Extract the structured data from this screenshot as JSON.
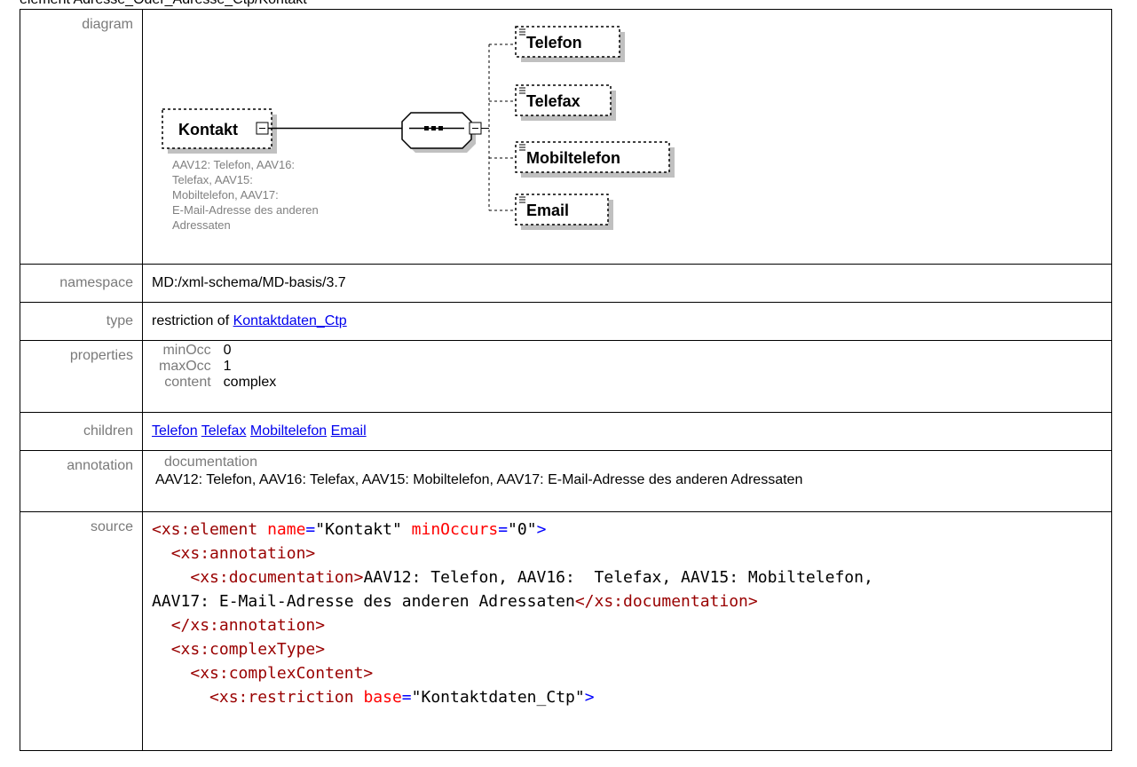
{
  "heading": "element Adresse_Oder_Adresse_Ctp/Kontakt",
  "rows": {
    "diagram": {
      "label": "diagram"
    },
    "namespace": {
      "label": "namespace",
      "value": "MD:/xml-schema/MD-basis/3.7"
    },
    "type": {
      "label": "type",
      "prefix": "restriction of ",
      "link": "Kontaktdaten_Ctp"
    },
    "properties": {
      "label": "properties",
      "items": [
        {
          "key": "minOcc",
          "value": "0"
        },
        {
          "key": "maxOcc",
          "value": "1"
        },
        {
          "key": "content",
          "value": "complex"
        }
      ]
    },
    "children": {
      "label": "children",
      "links": [
        "Telefon",
        "Telefax",
        "Mobiltelefon",
        "Email"
      ]
    },
    "annotation": {
      "label": "annotation",
      "doc_label": "documentation",
      "text": "AAV12: Telefon, AAV16:  Telefax, AAV15: Mobiltelefon, AAV17: E-Mail-Adresse des anderen Adressaten"
    },
    "source": {
      "label": "source"
    }
  },
  "diagram": {
    "main_element": "Kontakt",
    "main_doc_lines": [
      "AAV12: Telefon, AAV16:",
      "Telefax, AAV15:",
      "Mobiltelefon, AAV17:",
      "E-Mail-Adresse des anderen",
      "Adressaten"
    ],
    "children": [
      "Telefon",
      "Telefax",
      "Mobiltelefon",
      "Email"
    ],
    "colors": {
      "shadow": "#c0c0c0",
      "doc_text": "#808080",
      "line": "#000000"
    }
  },
  "source": {
    "l1": {
      "t1": "<xs:element",
      "a1": "name",
      "v1": "\"Kontakt\"",
      "a2": "minOccurs",
      "v2": "\"0\"",
      "end": ">"
    },
    "l2": {
      "t": "<xs:annotation>"
    },
    "l3": {
      "t1": "<xs:documentation>",
      "text": "AAV12: Telefon, AAV16:  Telefax, AAV15: Mobiltelefon,"
    },
    "l4": {
      "text": "AAV17: E-Mail-Adresse des anderen Adressaten",
      "t2": "</xs:documentation>"
    },
    "l5": {
      "t": "</xs:annotation>"
    },
    "l6": {
      "t": "<xs:complexType>"
    },
    "l7": {
      "t": "<xs:complexContent>"
    },
    "l8": {
      "t1": "<xs:restriction",
      "a1": "base",
      "v1": "\"Kontaktdaten_Ctp\"",
      "end": ">"
    }
  },
  "colors": {
    "tag": "#990000",
    "attr": "#ff0000",
    "punct": "#0000ff",
    "link": "#0000ee",
    "label": "#7a7a7a"
  }
}
